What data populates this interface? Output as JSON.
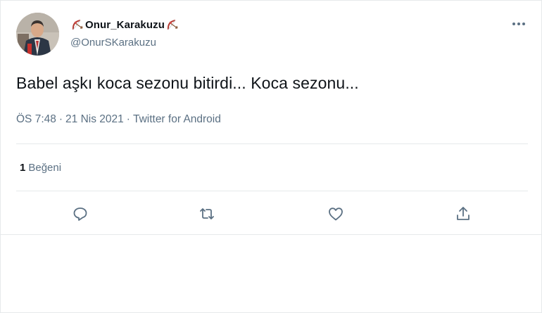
{
  "user": {
    "display_name": "Onur_Karakuzu",
    "handle": "@OnurSKarakuzu"
  },
  "tweet": {
    "text": "Babel aşkı koca sezonu bitirdi... Koca sezonu...",
    "time": "ÖS 7:48",
    "date": "21 Nis 2021",
    "separator": "·",
    "source": "Twitter for Android"
  },
  "stats": {
    "like_count": "1",
    "like_label": "Beğeni"
  },
  "icons": {
    "name_decoration": "bow-and-arrow-icon",
    "more": "more-horizontal-icon",
    "reply": "reply-icon",
    "retweet": "retweet-icon",
    "like": "like-icon",
    "share": "share-icon"
  },
  "colors": {
    "text_primary": "#0f1419",
    "text_secondary": "#5b7083",
    "border": "#e6e9eb",
    "bow_accent": "#d9534f"
  }
}
